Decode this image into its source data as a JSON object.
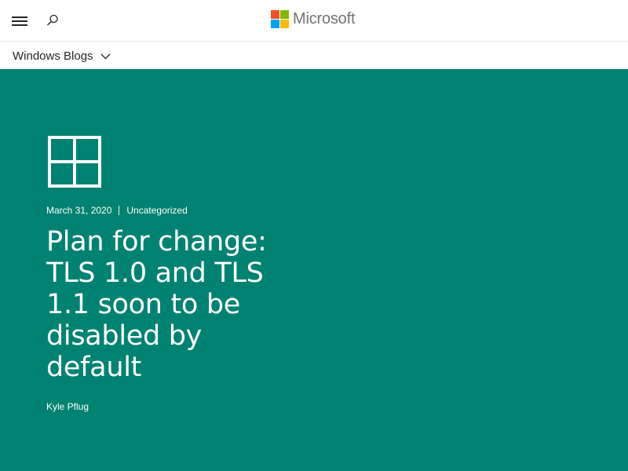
{
  "header": {
    "brand_name": "Microsoft",
    "menu_icon": "hamburger-icon",
    "search_icon": "search-icon",
    "logo_colors": [
      "#f25022",
      "#7fba00",
      "#00a4ef",
      "#ffb900"
    ]
  },
  "subnav": {
    "label": "Windows Blogs",
    "icon": "chevron-down-icon"
  },
  "hero": {
    "background_color": "#008272",
    "logo_icon": "windows-logo-icon",
    "date": "March 31, 2020",
    "category": "Uncategorized",
    "title": "Plan for change: TLS 1.0 and TLS 1.1 soon to be disabled by default",
    "author": "Kyle Pflug"
  }
}
